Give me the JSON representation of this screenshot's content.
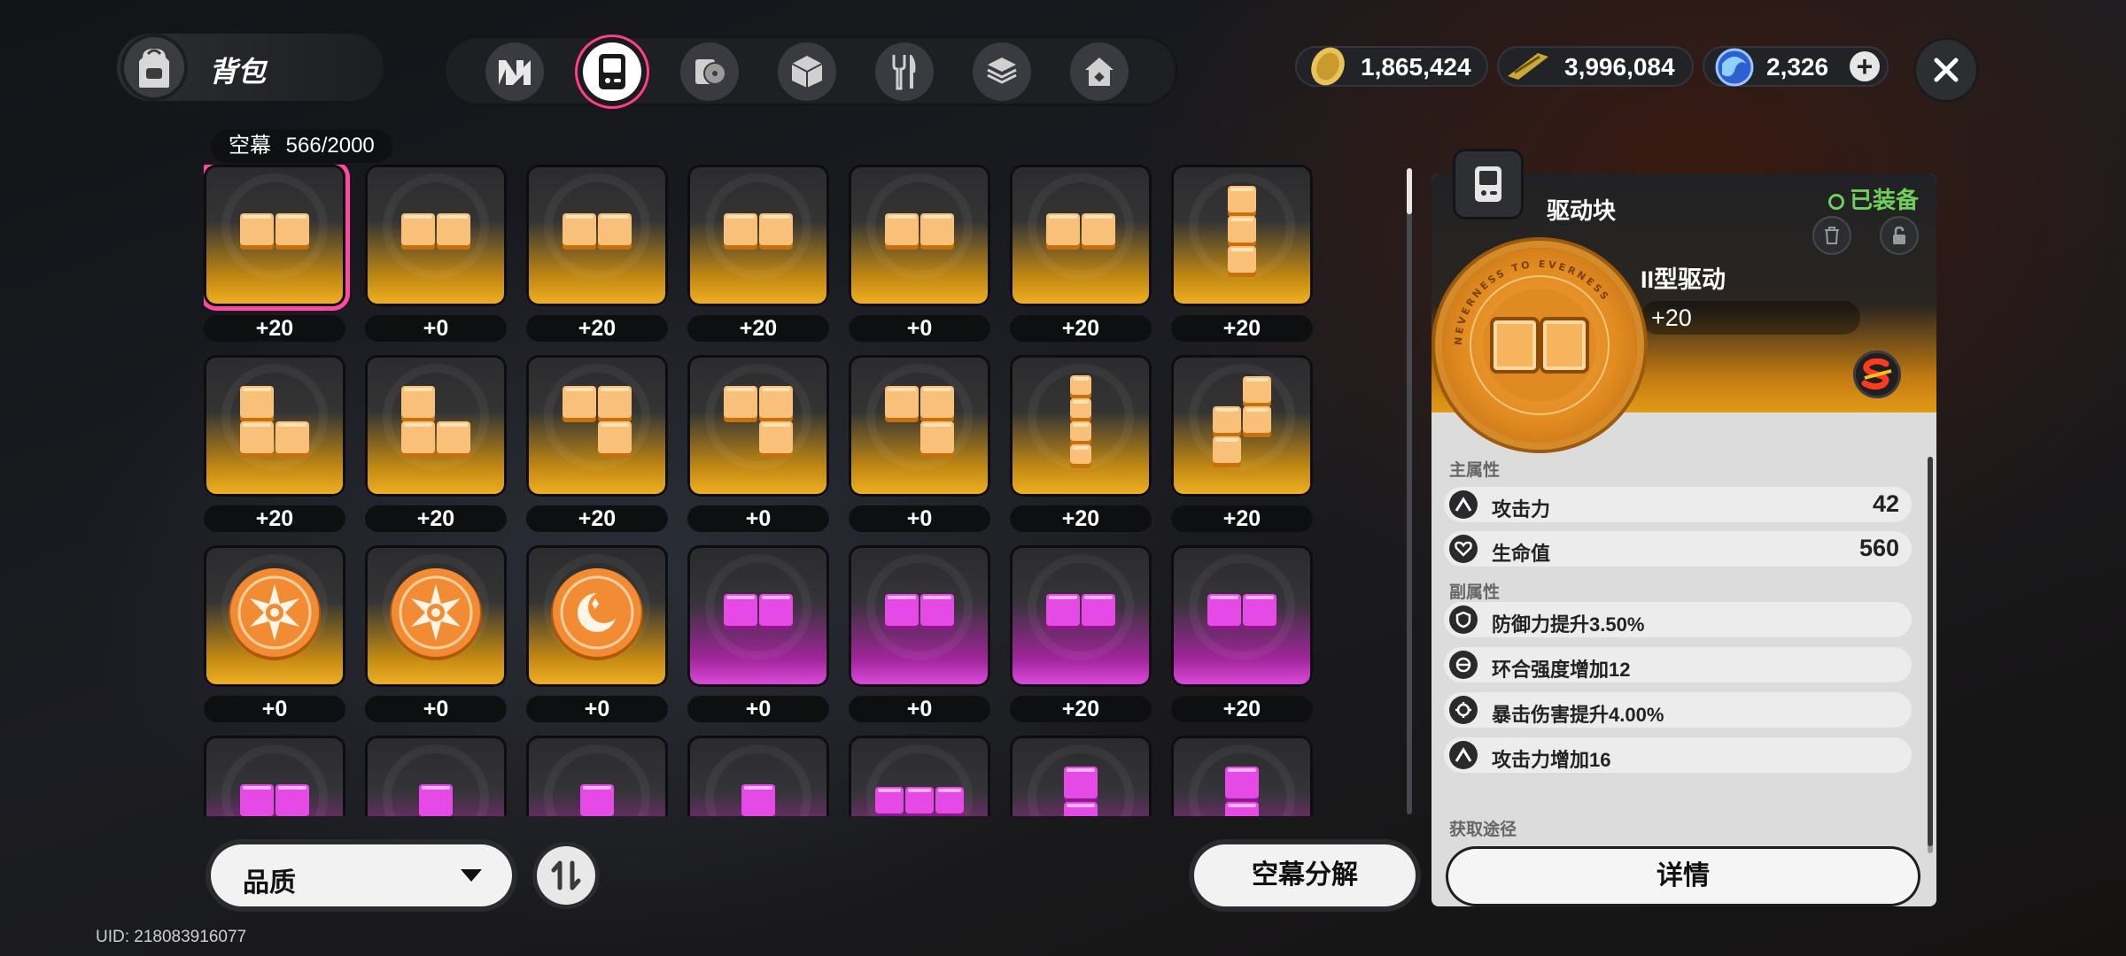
{
  "header": {
    "title": "背包",
    "tabs": [
      {
        "icon": "n-logo-icon"
      },
      {
        "icon": "handheld-device-icon",
        "active": true
      },
      {
        "icon": "disc-icon"
      },
      {
        "icon": "cube-icon"
      },
      {
        "icon": "fork-knife-icon"
      },
      {
        "icon": "stack-box-icon"
      },
      {
        "icon": "house-icon"
      }
    ],
    "currencies": [
      {
        "icon": "coin-icon",
        "value": "1,865,424"
      },
      {
        "icon": "ticket-icon",
        "value": "3,996,084"
      },
      {
        "icon": "polychrome-icon",
        "value": "2,326"
      }
    ]
  },
  "inventory": {
    "label": "空幕",
    "count": "566/2000",
    "rows": [
      {
        "cells": [
          {
            "rarity": "gold",
            "shape": "h2",
            "level": "+20",
            "selected": true
          },
          {
            "rarity": "gold",
            "shape": "h2",
            "level": "+0"
          },
          {
            "rarity": "gold",
            "shape": "h2",
            "level": "+20"
          },
          {
            "rarity": "gold",
            "shape": "h2",
            "level": "+20"
          },
          {
            "rarity": "gold",
            "shape": "h2",
            "level": "+0"
          },
          {
            "rarity": "gold",
            "shape": "h2",
            "level": "+20"
          },
          {
            "rarity": "gold",
            "shape": "v3",
            "level": "+20"
          }
        ]
      },
      {
        "cells": [
          {
            "rarity": "gold",
            "shape": "L",
            "level": "+20"
          },
          {
            "rarity": "gold",
            "shape": "L",
            "level": "+20"
          },
          {
            "rarity": "gold",
            "shape": "J",
            "level": "+20"
          },
          {
            "rarity": "gold",
            "shape": "J",
            "level": "+0"
          },
          {
            "rarity": "gold",
            "shape": "J",
            "level": "+0"
          },
          {
            "rarity": "gold",
            "shape": "v4",
            "level": "+20"
          },
          {
            "rarity": "gold",
            "shape": "S",
            "level": "+20"
          }
        ]
      },
      {
        "cells": [
          {
            "rarity": "gold",
            "shape": "disc-star",
            "level": "+0"
          },
          {
            "rarity": "gold",
            "shape": "disc-star",
            "level": "+0"
          },
          {
            "rarity": "gold",
            "shape": "disc-moon",
            "level": "+0"
          },
          {
            "rarity": "purple",
            "shape": "h2",
            "level": "+0"
          },
          {
            "rarity": "purple",
            "shape": "h2",
            "level": "+0"
          },
          {
            "rarity": "purple",
            "shape": "h2",
            "level": "+20"
          },
          {
            "rarity": "purple",
            "shape": "h2",
            "level": "+20"
          }
        ]
      },
      {
        "cells": [
          {
            "rarity": "purple",
            "shape": "h2",
            "level": ""
          },
          {
            "rarity": "purple",
            "shape": "v1",
            "level": ""
          },
          {
            "rarity": "purple",
            "shape": "v1",
            "level": ""
          },
          {
            "rarity": "purple",
            "shape": "v1",
            "level": ""
          },
          {
            "rarity": "purple",
            "shape": "h3",
            "level": ""
          },
          {
            "rarity": "purple",
            "shape": "v2",
            "level": ""
          },
          {
            "rarity": "purple",
            "shape": "v2",
            "level": ""
          }
        ]
      }
    ]
  },
  "detail": {
    "category": "驱动块",
    "equipped": "已装备",
    "name": "II型驱动",
    "level": "+20",
    "medal_text": "NEVERNESS TO EVERNESS",
    "main_header": "主属性",
    "main_stats": [
      {
        "icon": "attack-icon",
        "name": "攻击力",
        "value": "42"
      },
      {
        "icon": "heart-icon",
        "name": "生命值",
        "value": "560"
      }
    ],
    "sub_header": "副属性",
    "sub_stats": [
      {
        "icon": "shield-icon",
        "name": "防御力提升3.50%"
      },
      {
        "icon": "ring-icon",
        "name": "环合强度增加12"
      },
      {
        "icon": "crosshair-icon",
        "name": "暴击伤害提升4.00%"
      },
      {
        "icon": "attack-icon",
        "name": "攻击力增加16"
      }
    ],
    "source_header": "获取途径",
    "detail_button": "详情"
  },
  "controls": {
    "quality_label": "品质",
    "decompose_label": "空幕分解"
  },
  "uid": "UID: 218083916077",
  "colors": {
    "gold": "#f3b226",
    "purple": "#e04de0",
    "selected": "#ff4aa0",
    "equipped": "#6fd15a"
  }
}
